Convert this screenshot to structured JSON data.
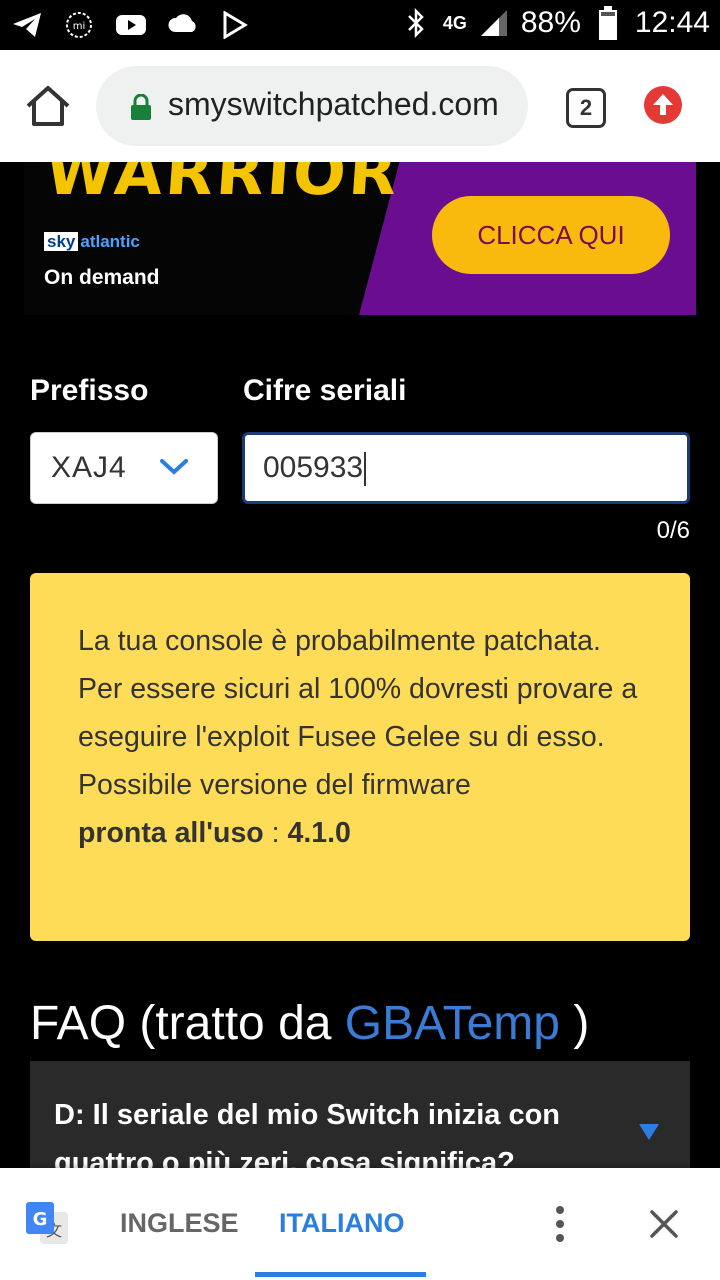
{
  "status_bar": {
    "network": "4G",
    "battery": "88%",
    "time": "12:44",
    "icons": [
      "telegram-icon",
      "mi-icon",
      "youtube-icon",
      "cloud-icon",
      "play-store-icon",
      "bluetooth-icon",
      "signal-icon",
      "battery-icon"
    ]
  },
  "browser": {
    "url": "smyswitchpatched.com",
    "tab_count": "2"
  },
  "ad": {
    "title": "WARRIOR",
    "network_logo": "sky",
    "network_name": "atlantic",
    "subtitle": "On demand",
    "cta": "CLICCA QUI"
  },
  "form": {
    "prefix_label": "Prefisso",
    "serial_label": "Cifre seriali",
    "prefix_value": "XAJ4",
    "serial_value": "005933",
    "counter": "0/6"
  },
  "result": {
    "text": "La tua console è probabilmente patchata. Per essere sicuri al 100% dovresti provare a eseguire l'exploit Fusee Gelee su di esso.",
    "firmware_prefix": "Possibile versione del firmware",
    "firmware_label": "pronta all'uso",
    "firmware_sep": " : ",
    "firmware_version": "4.1.0"
  },
  "faq": {
    "title_prefix": "FAQ (tratto da ",
    "title_link": "GBATemp",
    "title_suffix": " )",
    "question": "D: Il seriale del mio Switch inizia con quattro o più zeri, cosa significa?"
  },
  "translate_bar": {
    "lang_from": "INGLESE",
    "lang_to": "ITALIANO"
  },
  "colors": {
    "accent": "#2a7de1",
    "result_bg": "#ffdc57",
    "ad_purple": "#6a0d91",
    "ad_cta": "#f9b90d"
  }
}
